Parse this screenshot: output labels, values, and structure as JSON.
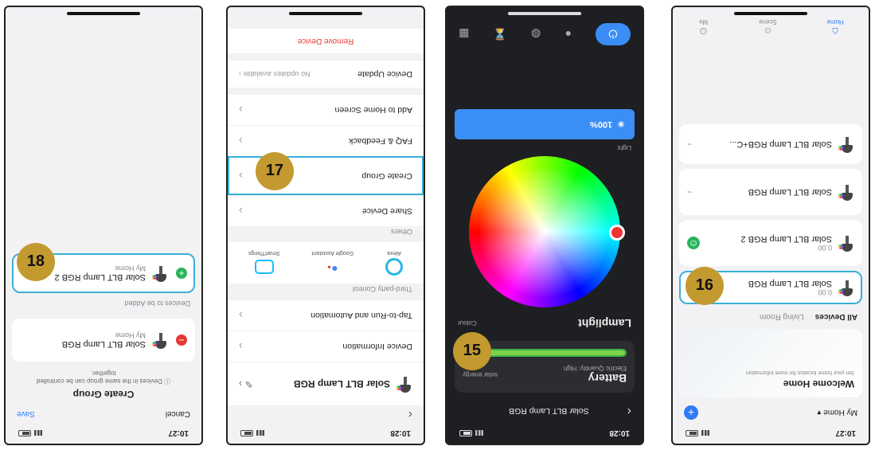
{
  "badges": [
    "15",
    "16",
    "17",
    "18"
  ],
  "screen15": {
    "time": "10:28",
    "title": "Solar BLT Lamp RGB",
    "battery_title": "Battery",
    "battery_sub": "Electric Quantity: High",
    "battery_side": "solar energy",
    "lamp_label": "Lamplight",
    "colour_label": "Colour",
    "light_label": "Light",
    "brightness": "100%",
    "brightness_value": 1.0,
    "accent": "#3a8ef6"
  },
  "screen16": {
    "time": "10:27",
    "home_label": "My Home",
    "welcome_title": "Welcome Home",
    "welcome_sub": "Set your home location for more information",
    "tabs": [
      "All Devices",
      "Living Room"
    ],
    "devices": [
      {
        "name": "Solar BLT Lamp RGB",
        "sub": "0.00"
      },
      {
        "name": "Solar BLT Lamp RGB 2",
        "sub": "0.00"
      },
      {
        "name": "Solar BLT Lamp RGB",
        "sub": ""
      },
      {
        "name": "Solar BLT Lamp RGB+C...",
        "sub": ""
      }
    ],
    "nav": [
      "Home",
      "Scene",
      "Me"
    ]
  },
  "screen17": {
    "time": "10:28",
    "device_name": "Solar BLT Lamp RGB",
    "rows_top": [
      "Device Information",
      "Tap-to-Run and Automation"
    ],
    "third_party_label": "Third-party Control",
    "third_party": [
      "Alexa",
      "Google Assistant",
      "SmartThings"
    ],
    "others_label": "Others",
    "rows_others": [
      "Share Device",
      "Create Group",
      "FAQ & Feedback",
      "Add to Home Screen"
    ],
    "update_label": "Device Update",
    "update_value": "No updates available",
    "remove": "Remove Device"
  },
  "screen18": {
    "time": "10:27",
    "cancel": "Cancel",
    "save": "Save",
    "title": "Create Group",
    "hint": "Devices in the same group can be controlled together.",
    "group_members": [
      {
        "name": "Solar BLT Lamp RGB",
        "room": "My Home"
      }
    ],
    "to_add_label": "Devices to be Added",
    "to_add": [
      {
        "name": "Solar BLT Lamp RGB 2",
        "room": "My Home"
      }
    ]
  }
}
